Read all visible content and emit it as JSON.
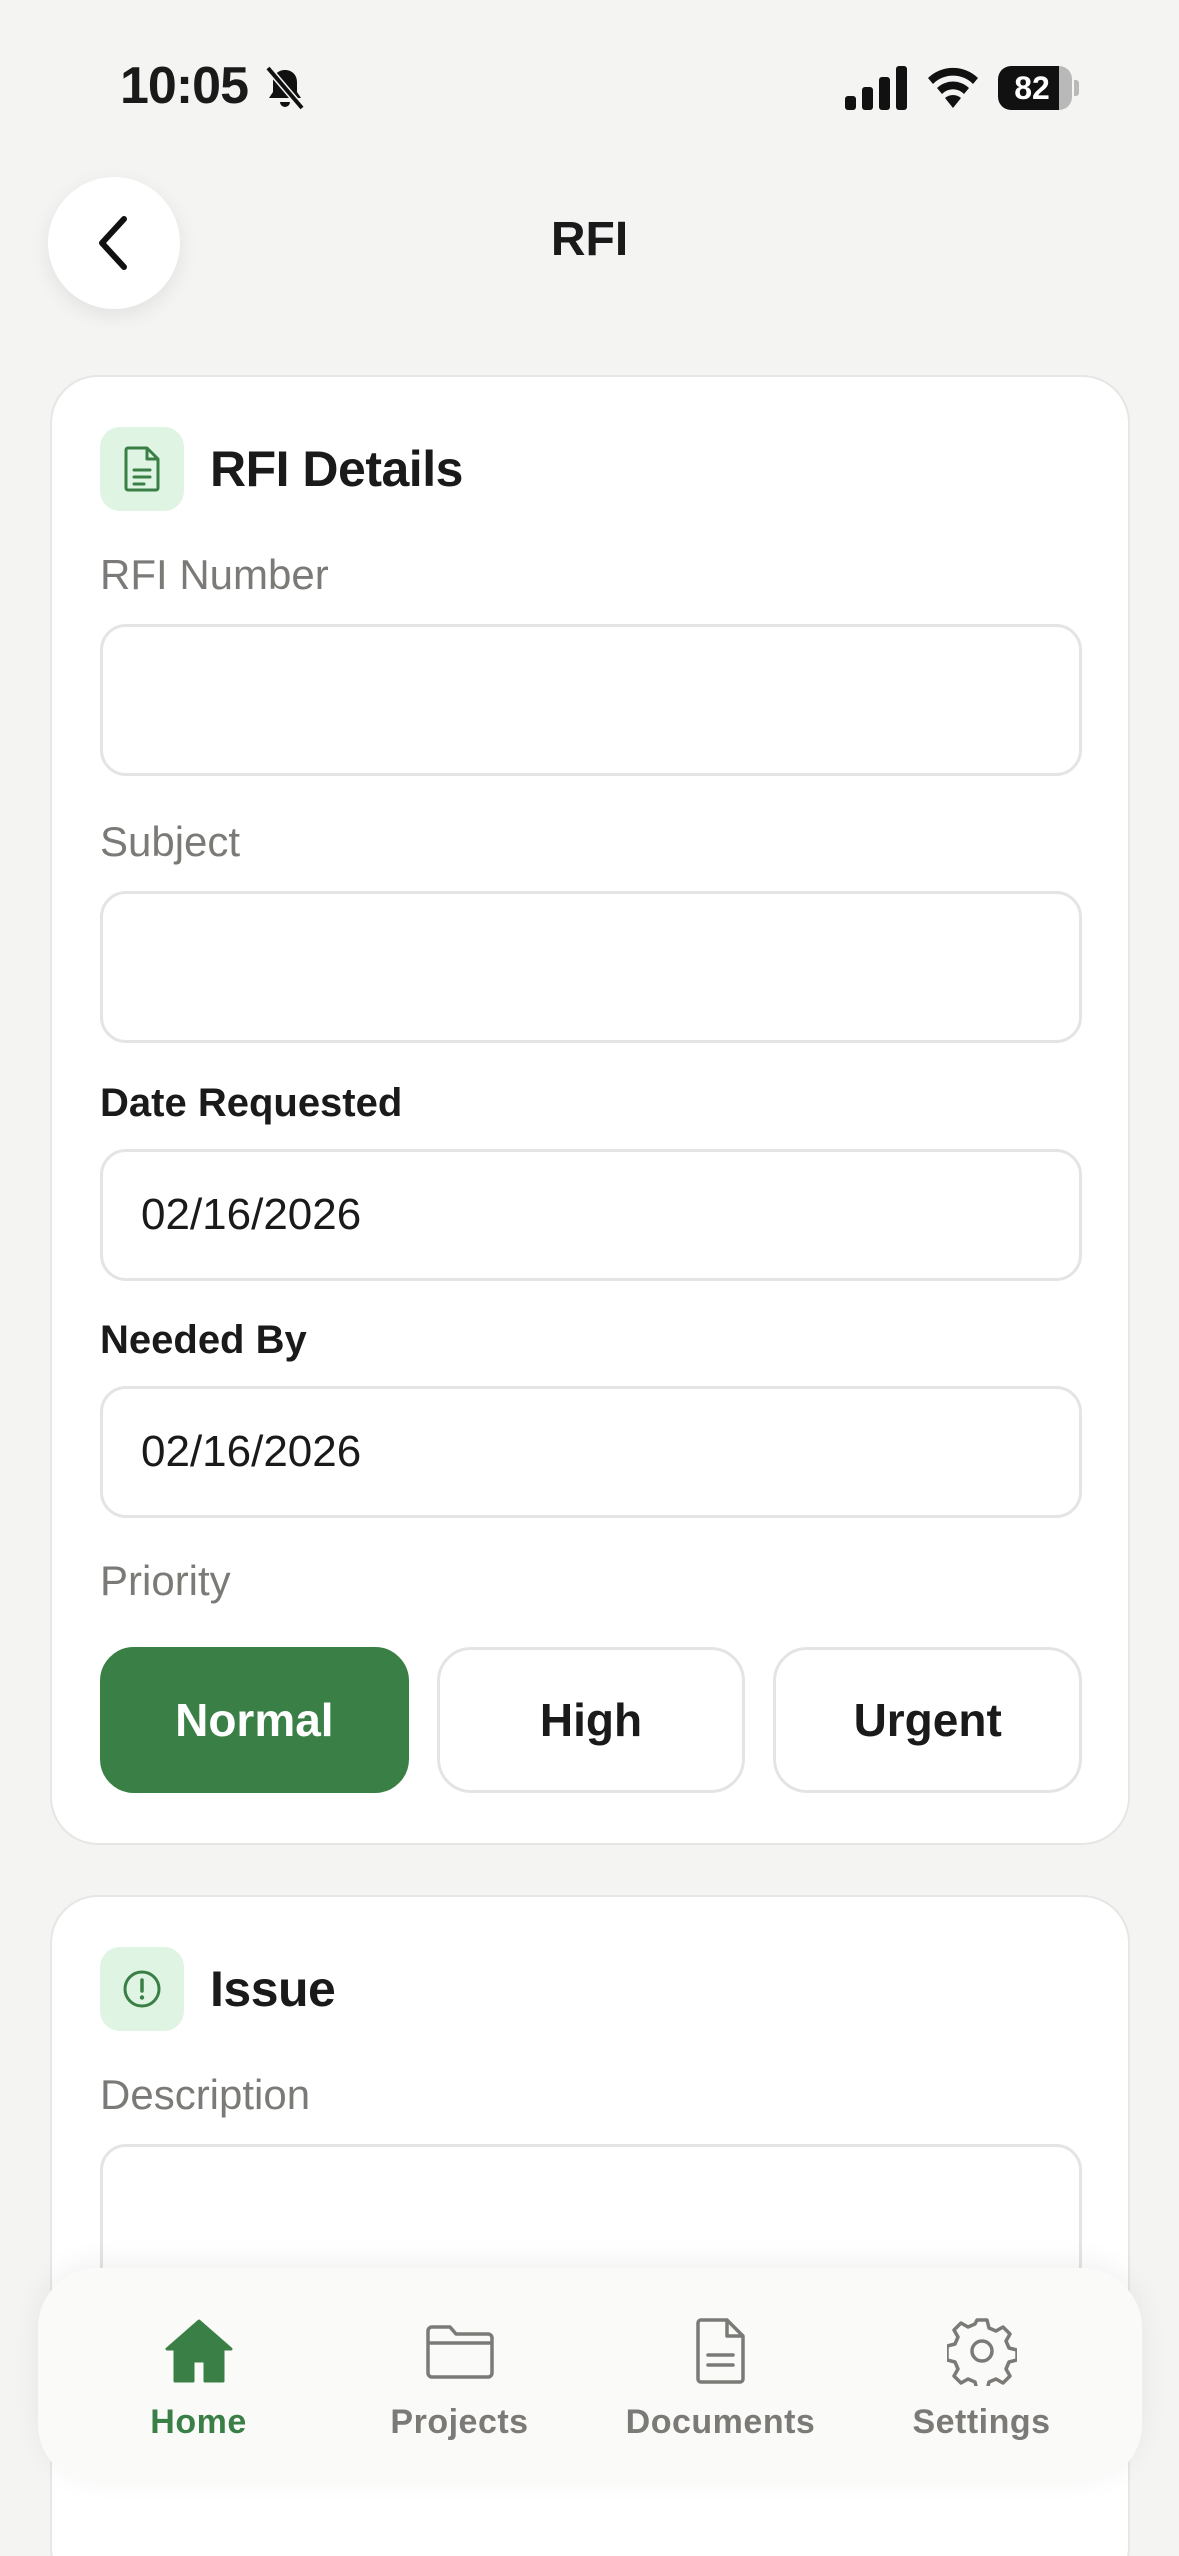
{
  "status_bar": {
    "time": "10:05",
    "battery": "82",
    "battery_level": 0.82
  },
  "header": {
    "title": "RFI"
  },
  "rfi_details": {
    "title": "RFI Details",
    "rfi_number": {
      "label": "RFI Number",
      "value": ""
    },
    "subject": {
      "label": "Subject",
      "value": ""
    },
    "date_requested": {
      "label": "Date Requested",
      "value": "02/16/2026"
    },
    "needed_by": {
      "label": "Needed By",
      "value": "02/16/2026"
    },
    "priority": {
      "label": "Priority",
      "options": [
        "Normal",
        "High",
        "Urgent"
      ],
      "selected": "Normal"
    }
  },
  "issue": {
    "title": "Issue",
    "description": {
      "label": "Description",
      "value": ""
    }
  },
  "nav": {
    "items": [
      {
        "label": "Home",
        "icon": "home-icon",
        "active": true
      },
      {
        "label": "Projects",
        "icon": "folder-icon",
        "active": false
      },
      {
        "label": "Documents",
        "icon": "document-icon",
        "active": false
      },
      {
        "label": "Settings",
        "icon": "gear-icon",
        "active": false
      }
    ]
  },
  "colors": {
    "accent": "#3a7f45",
    "icon_bg": "#dff4e2",
    "background": "#f4f4f3"
  }
}
